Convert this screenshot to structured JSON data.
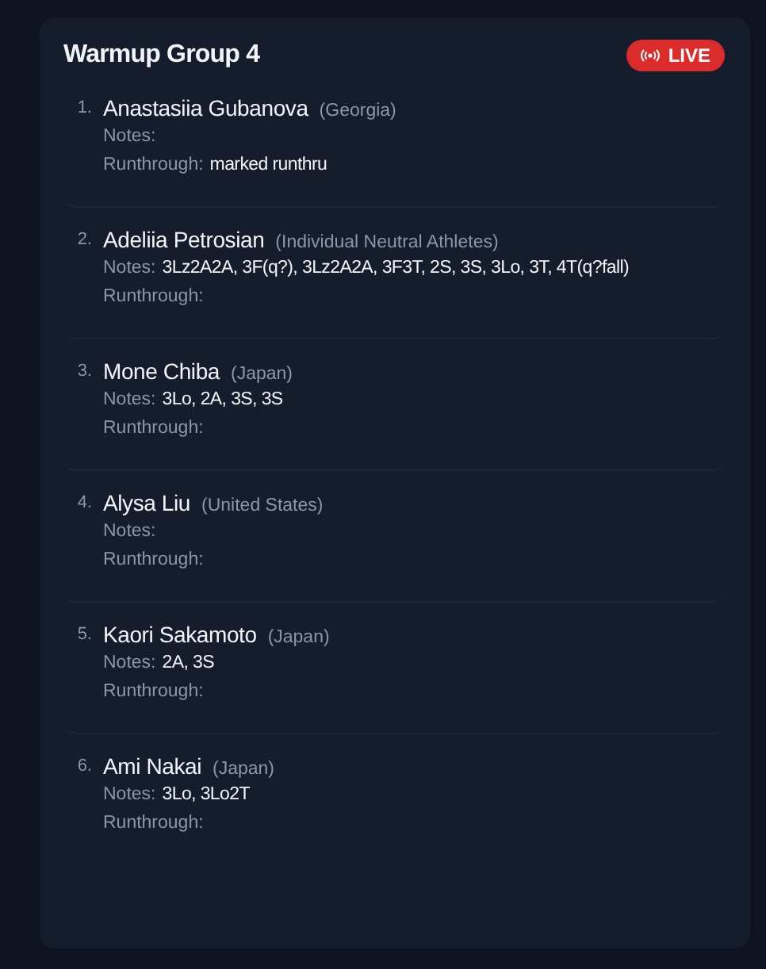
{
  "group": {
    "title": "Warmup Group 4",
    "live_badge": {
      "label": "LIVE",
      "on": true
    }
  },
  "skaters": [
    {
      "number": "1.",
      "name": "Anastasiia Gubanova",
      "country": "(Georgia)",
      "notes_label": "Notes:",
      "runthrough_label": "Runthrough:",
      "runthrough": "marked runthru"
    },
    {
      "number": "2.",
      "name": "Adeliia Petrosian",
      "country": "(Individual Neutral Athletes)",
      "notes_label": "Notes:",
      "notes": "3Lz2A2A, 3F(q?), 3Lz2A2A, 3F3T, 2S, 3S, 3Lo, 3T, 4T(q?fall)",
      "runthrough_label": "Runthrough:"
    },
    {
      "number": "3.",
      "name": "Mone Chiba",
      "country": "(Japan)",
      "notes_label": "Notes:",
      "notes": "3Lo, 2A, 3S, 3S",
      "runthrough_label": "Runthrough:"
    },
    {
      "number": "4.",
      "name": "Alysa Liu",
      "country": "(United States)",
      "notes_label": "Notes:",
      "runthrough_label": "Runthrough:"
    },
    {
      "number": "5.",
      "name": "Kaori Sakamoto",
      "country": "(Japan)",
      "notes_label": "Notes:",
      "notes": "2A, 3S",
      "runthrough_label": "Runthrough:"
    },
    {
      "number": "6.",
      "name": "Ami Nakai",
      "country": "(Japan)",
      "notes_label": "Notes:",
      "notes": "3Lo, 3Lo2T",
      "runthrough_label": "Runthrough:"
    }
  ]
}
